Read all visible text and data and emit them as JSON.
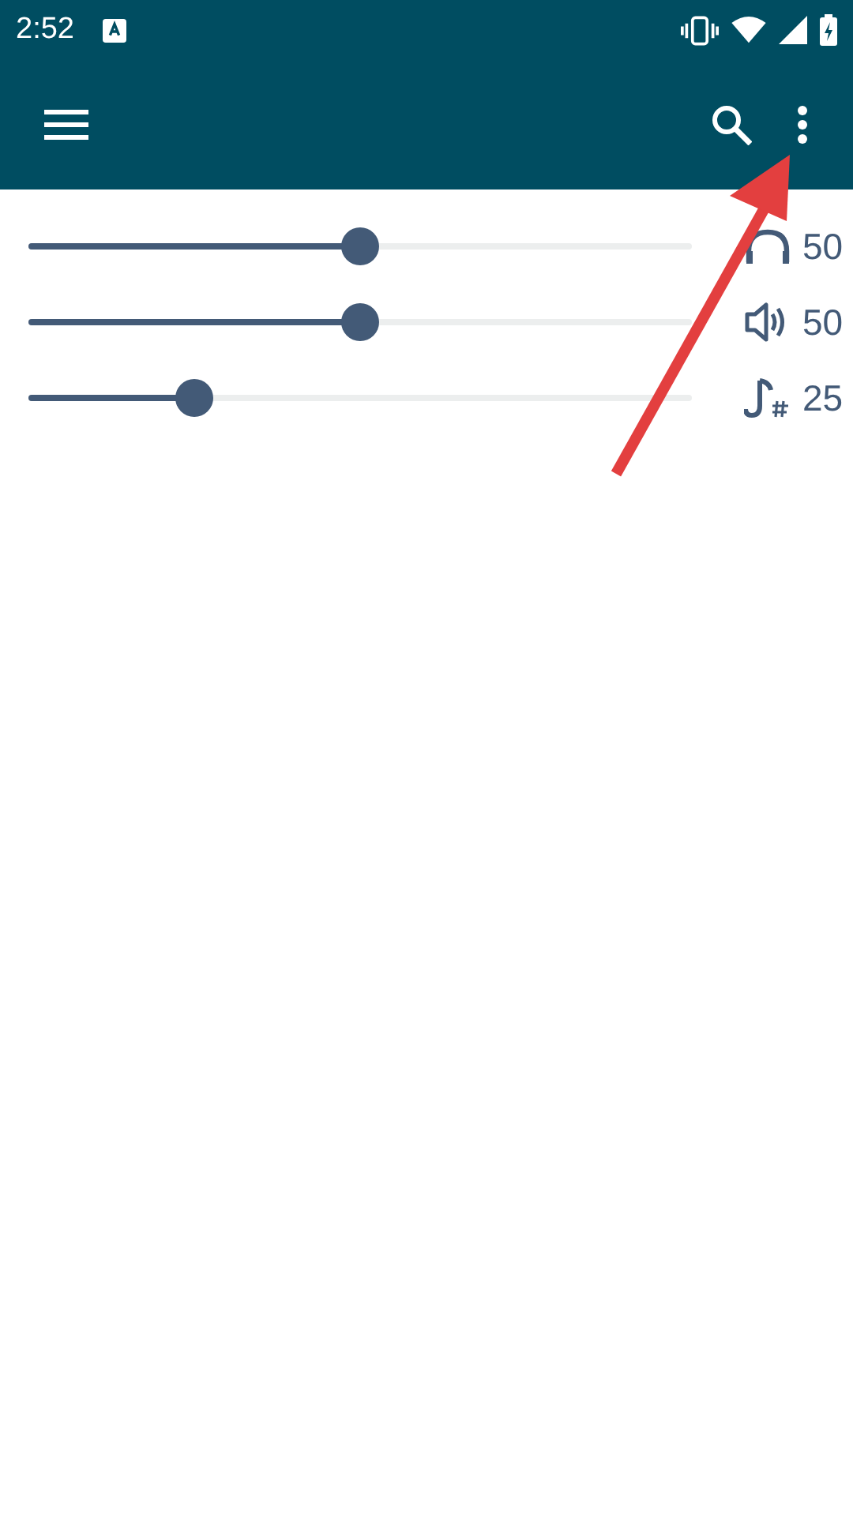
{
  "status_bar": {
    "time": "2:52"
  },
  "sliders": [
    {
      "kind": "headphones",
      "level": 0.5,
      "reading": "50"
    },
    {
      "kind": "speaker",
      "level": 0.5,
      "reading": "50"
    },
    {
      "kind": "pitch",
      "level": 0.25,
      "reading": "25"
    }
  ]
}
